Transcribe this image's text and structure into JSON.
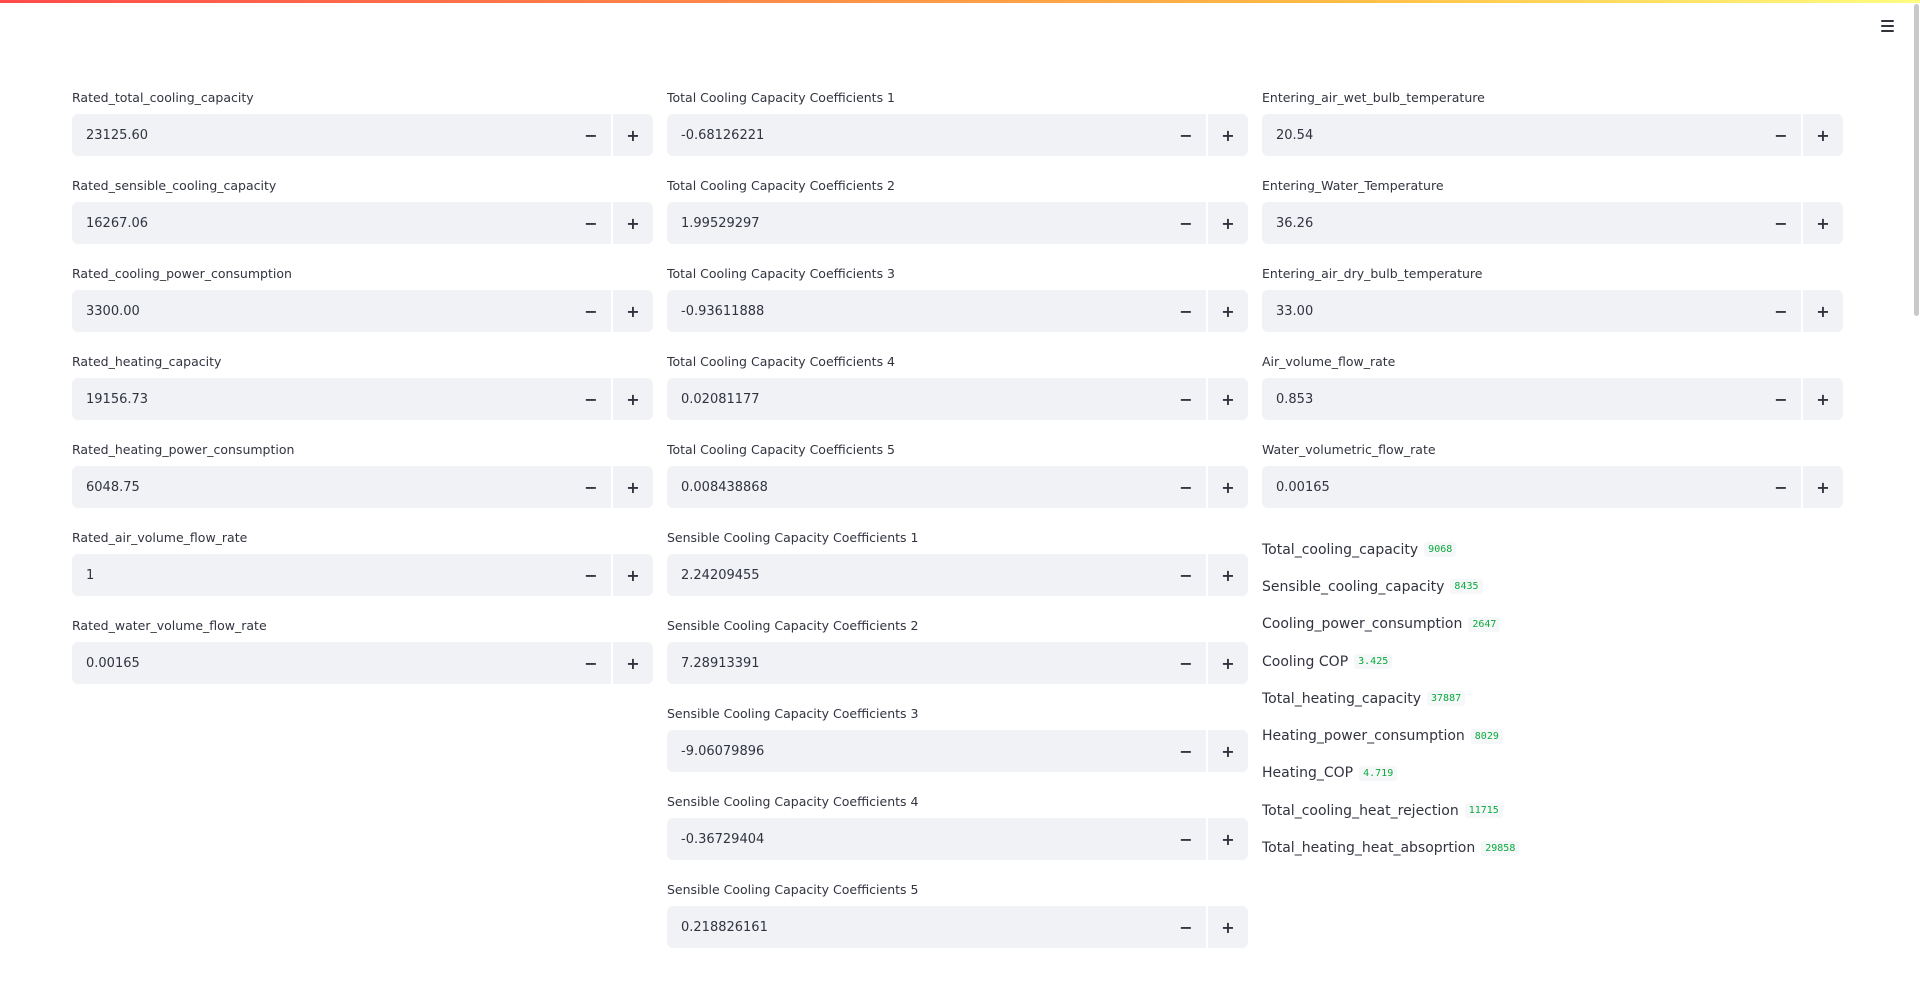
{
  "menu": {
    "icon": "hamburger-menu-icon"
  },
  "colors": {
    "accent_start": "#ff4b4b",
    "accent_end": "#fffd80",
    "input_bg": "#f0f2f6",
    "metric_value": "#09ab3b"
  },
  "col1": [
    {
      "label": "Rated_total_cooling_capacity",
      "value": "23125.60"
    },
    {
      "label": "Rated_sensible_cooling_capacity",
      "value": "16267.06"
    },
    {
      "label": "Rated_cooling_power_consumption",
      "value": "3300.00"
    },
    {
      "label": "Rated_heating_capacity",
      "value": "19156.73"
    },
    {
      "label": "Rated_heating_power_consumption",
      "value": "6048.75"
    },
    {
      "label": "Rated_air_volume_flow_rate",
      "value": "1"
    },
    {
      "label": "Rated_water_volume_flow_rate",
      "value": "0.00165"
    }
  ],
  "col2": [
    {
      "label": "Total Cooling Capacity Coefficients 1",
      "value": "-0.68126221"
    },
    {
      "label": "Total Cooling Capacity Coefficients 2",
      "value": "1.99529297"
    },
    {
      "label": "Total Cooling Capacity Coefficients 3",
      "value": "-0.93611888"
    },
    {
      "label": "Total Cooling Capacity Coefficients 4",
      "value": "0.02081177"
    },
    {
      "label": "Total Cooling Capacity Coefficients 5",
      "value": "0.008438868"
    },
    {
      "label": "Sensible Cooling Capacity Coefficients 1",
      "value": "2.24209455"
    },
    {
      "label": "Sensible Cooling Capacity Coefficients 2",
      "value": "7.28913391"
    },
    {
      "label": "Sensible Cooling Capacity Coefficients 3",
      "value": "-9.06079896"
    },
    {
      "label": "Sensible Cooling Capacity Coefficients 4",
      "value": "-0.36729404"
    },
    {
      "label": "Sensible Cooling Capacity Coefficients 5",
      "value": "0.218826161"
    }
  ],
  "col3": [
    {
      "label": "Entering_air_wet_bulb_temperature",
      "value": "20.54"
    },
    {
      "label": "Entering_Water_Temperature",
      "value": "36.26"
    },
    {
      "label": "Entering_air_dry_bulb_temperature",
      "value": "33.00"
    },
    {
      "label": "Air_volume_flow_rate",
      "value": "0.853"
    },
    {
      "label": "Water_volumetric_flow_rate",
      "value": "0.00165"
    }
  ],
  "stepper": {
    "minus": "−",
    "plus": "+"
  },
  "metrics": [
    {
      "label": "Total_cooling_capacity",
      "value": "9068"
    },
    {
      "label": "Sensible_cooling_capacity",
      "value": "8435"
    },
    {
      "label": "Cooling_power_consumption",
      "value": "2647"
    },
    {
      "label": "Cooling COP",
      "value": "3.425"
    },
    {
      "label": "Total_heating_capacity",
      "value": "37887"
    },
    {
      "label": "Heating_power_consumption",
      "value": "8029"
    },
    {
      "label": "Heating_COP",
      "value": "4.719"
    },
    {
      "label": "Total_cooling_heat_rejection",
      "value": "11715"
    },
    {
      "label": "Total_heating_heat_absoprtion",
      "value": "29858"
    }
  ]
}
